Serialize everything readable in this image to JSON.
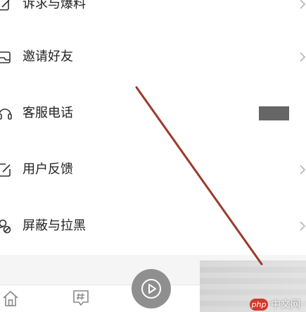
{
  "menu": {
    "items": [
      {
        "label": "诉求与爆料",
        "icon": "edit-note-icon",
        "has_chevron": true
      },
      {
        "label": "邀请好友",
        "icon": "invite-mail-icon",
        "has_chevron": true
      },
      {
        "label": "客服电话",
        "icon": "headset-icon",
        "has_chevron": false
      },
      {
        "label": "用户反馈",
        "icon": "feedback-edit-icon",
        "has_chevron": true
      },
      {
        "label": "屏蔽与拉黑",
        "icon": "block-user-icon",
        "has_chevron": true
      }
    ]
  },
  "tabbar": {
    "items": [
      {
        "icon": "home-icon"
      },
      {
        "icon": "topic-hash-icon"
      },
      {
        "icon": "play-icon"
      }
    ]
  },
  "watermark": {
    "badge": "php",
    "text": "中文网"
  },
  "colors": {
    "annotation_line": "#9b3a2b",
    "text": "#222222",
    "icon": "#333333",
    "chevron": "#b5b5b5",
    "redacted_block": "#666666",
    "play_button": "#8f8f8f",
    "watermark_badge": "#d23a2a"
  }
}
